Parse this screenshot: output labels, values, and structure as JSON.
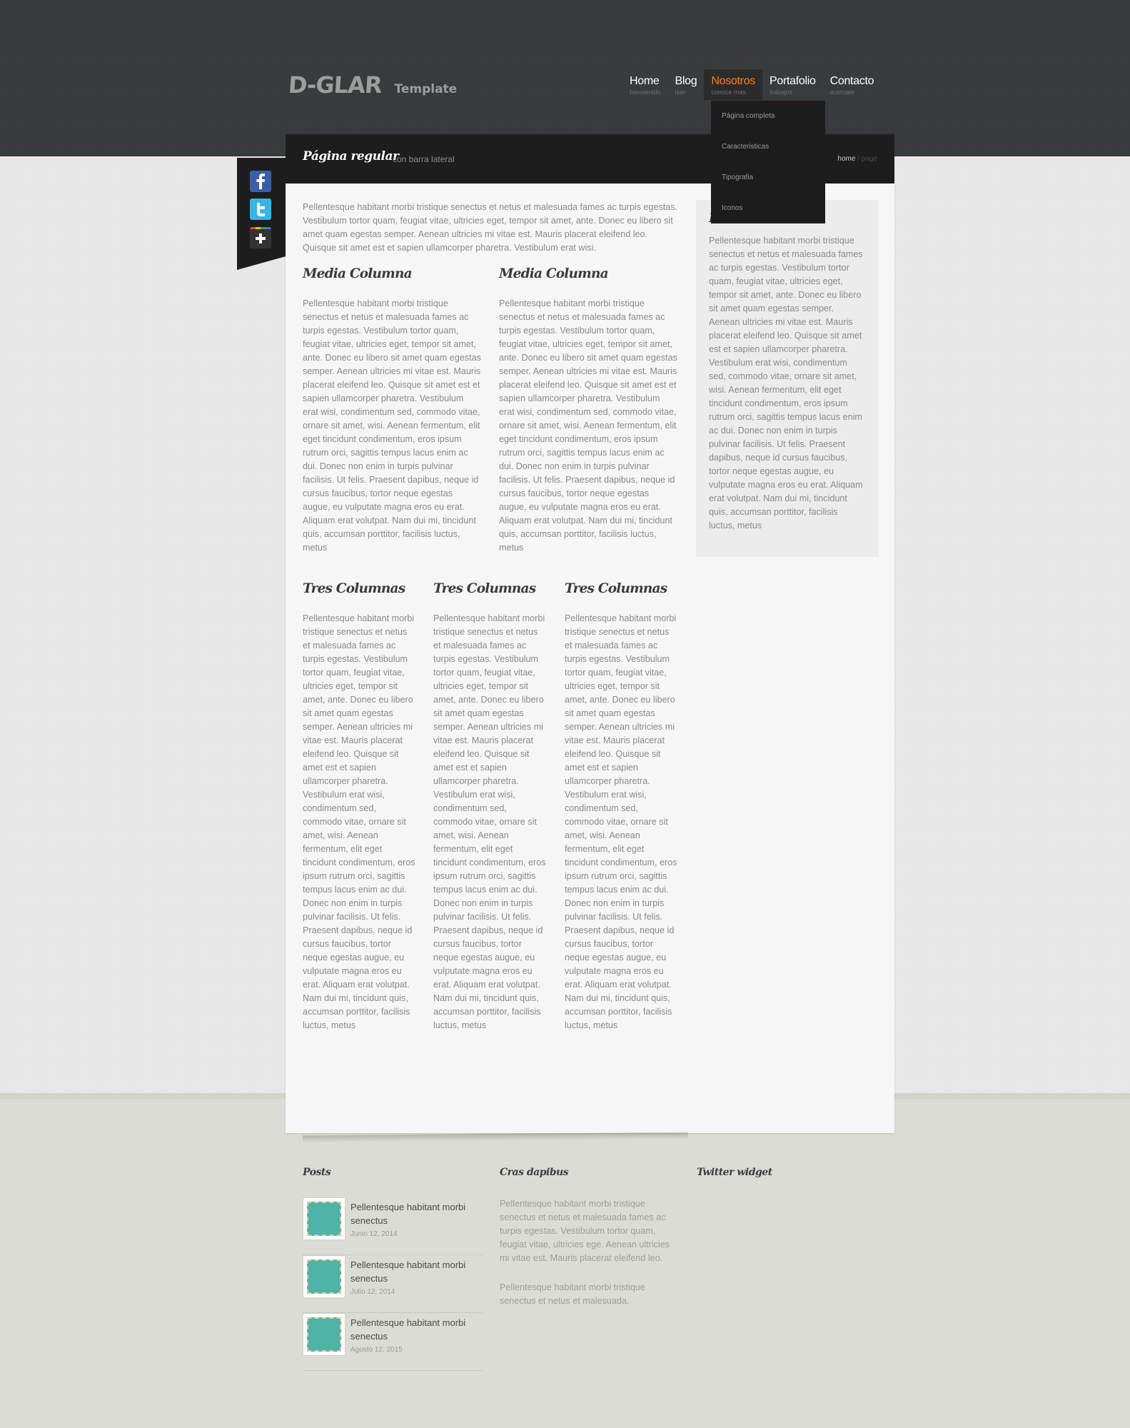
{
  "brand": {
    "logo": "D-GLAR",
    "tagline": "Template"
  },
  "nav": [
    {
      "label": "Home",
      "sub": "bienvenido"
    },
    {
      "label": "Blog",
      "sub": "leer"
    },
    {
      "label": "Nosotros",
      "sub": "conoce mas"
    },
    {
      "label": "Portafolio",
      "sub": "trabajos"
    },
    {
      "label": "Contacto",
      "sub": "acercate"
    }
  ],
  "dropdown": [
    "Página completa",
    "Caracteristicas",
    "Tipografia",
    "Iconos"
  ],
  "title_bar": {
    "title": "Página regular",
    "subtitle": "con barra lateral",
    "crumb_home": "home",
    "crumb_sep": " / ",
    "crumb_current": "page"
  },
  "social": [
    "facebook-icon",
    "twitter-icon",
    "add-icon"
  ],
  "content": {
    "intro": "Pellentesque habitant morbi tristique senectus et netus et malesuada fames ac turpis egestas. Vestibulum tortor quam, feugiat vitae, ultricies eget, tempor sit amet, ante. Donec eu libero sit amet quam egestas semper. Aenean ultricies mi vitae est. Mauris placerat eleifend leo. Quisque sit amet est et sapien ullamcorper pharetra. Vestibulum erat wisi.",
    "half_heading": "Media Columna",
    "half_text": "Pellentesque habitant morbi tristique senectus et netus et malesuada fames ac turpis egestas. Vestibulum tortor quam, feugiat vitae, ultricies eget, tempor sit amet, ante. Donec eu libero sit amet quam egestas semper. Aenean ultricies mi vitae est. Mauris placerat eleifend leo. Quisque sit amet est et sapien ullamcorper pharetra. Vestibulum erat wisi, condimentum sed, commodo vitae, ornare sit amet, wisi. Aenean fermentum, elit eget tincidunt condimentum, eros ipsum rutrum orci, sagittis tempus lacus enim ac dui. Donec non enim in turpis pulvinar facilisis. Ut felis. Praesent dapibus, neque id cursus faucibus, tortor neque egestas augue, eu vulputate magna eros eu erat. Aliquam erat volutpat. Nam dui mi, tincidunt quis, accumsan porttitor, facilisis luctus, metus",
    "third_heading": "Tres Columnas",
    "third_text": "Pellentesque habitant morbi tristique senectus et netus et malesuada fames ac turpis egestas. Vestibulum tortor quam, feugiat vitae, ultricies eget, tempor sit amet, ante. Donec eu libero sit amet quam egestas semper. Aenean ultricies mi vitae est. Mauris placerat eleifend leo. Quisque sit amet est et sapien ullamcorper pharetra. Vestibulum erat wisi, condimentum sed, commodo vitae, ornare sit amet, wisi. Aenean fermentum, elit eget tincidunt condimentum, eros ipsum rutrum orci, sagittis tempus lacus enim ac dui. Donec non enim in turpis pulvinar facilisis. Ut felis. Praesent dapibus, neque id cursus faucibus, tortor neque egestas augue, eu vulputate magna eros eu erat. Aliquam erat volutpat. Nam dui mi, tincidunt quis, accumsan porttitor, facilisis luctus, metus"
  },
  "sidebar": {
    "heading": "B",
    "text": "Pellentesque habitant morbi tristique senectus et netus et malesuada fames ac turpis egestas. Vestibulum tortor quam, feugiat vitae, ultricies eget, tempor sit amet, ante. Donec eu libero sit amet quam egestas semper. Aenean ultricies mi vitae est. Mauris placerat eleifend leo. Quisque sit amet est et sapien ullamcorper pharetra. Vestibulum erat wisi, condimentum sed, commodo vitae, ornare sit amet, wisi. Aenean fermentum, elit eget tincidunt condimentum, eros ipsum rutrum orci, sagittis tempus lacus enim ac dui. Donec non enim in turpis pulvinar facilisis. Ut felis. Praesent dapibus, neque id cursus faucibus, tortor neque egestas augue, eu vulputate magna eros eu erat. Aliquam erat volutpat. Nam dui mi, tincidunt quis, accumsan porttitor, facilisis luctus, metus"
  },
  "footer": {
    "posts_heading": "Posts",
    "posts": [
      {
        "title": "Pellentesque habitant morbi senectus",
        "date": "Junio 12, 2014"
      },
      {
        "title": "Pellentesque habitant morbi senectus",
        "date": "Julio 12, 2014"
      },
      {
        "title": "Pellentesque habitant morbi senectus",
        "date": "Agosto 12, 2015"
      }
    ],
    "middle_heading": "Cras dapibus",
    "middle_p1": "Pellentesque habitant morbi tristique senectus et netus et malesuada fames ac turpis egestas. Vestibulum tortor quam, feugiat vitae, ultricies ege. Aenean ultricies mi vitae est. Mauris placerat eleifend leo.",
    "middle_p2": "Pellentesque habitant morbi tristique senectus et netus et malesuada.",
    "twitter_heading": "Twitter widget"
  },
  "colors": {
    "accent": "#ff7d1a",
    "header_bg": "#373b3c",
    "bar_bg": "#1d1d1d"
  }
}
